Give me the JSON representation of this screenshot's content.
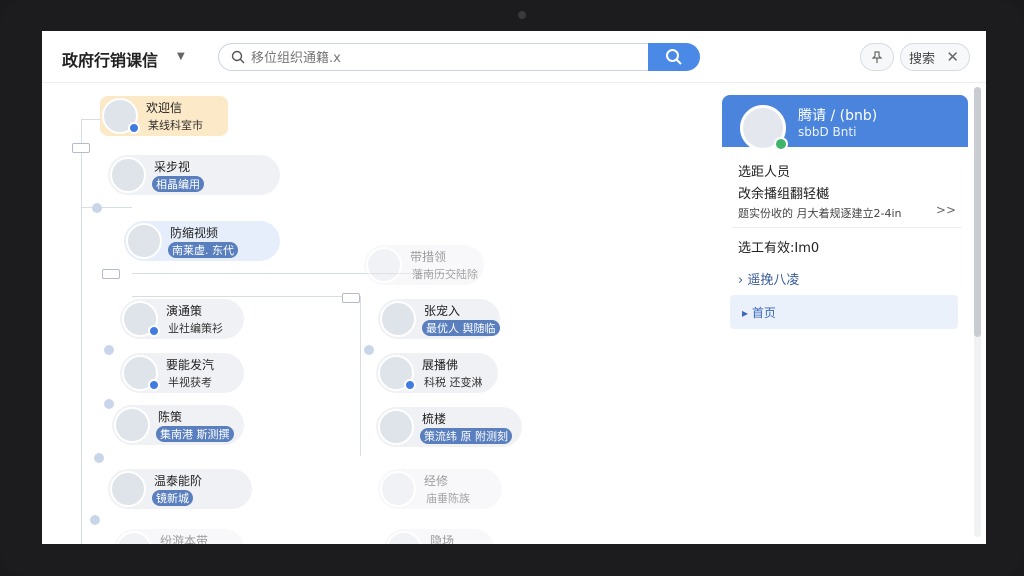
{
  "header": {
    "title": "政府行销课信",
    "search_placeholder": "移位组织通籍.x",
    "search_button_label": "搜索"
  },
  "tree": {
    "root": {
      "name": "欢迎信",
      "role": "某线科室市"
    },
    "left_nodes": [
      {
        "name": "采步视",
        "role": "相晶编用"
      },
      {
        "name": "防缩视频",
        "role": "南莱虚. 东代"
      },
      {
        "name": "演通策",
        "role": "业社编策衫"
      },
      {
        "name": "要能发汽",
        "role": "半视获考"
      },
      {
        "name": "陈策",
        "role": "集南港 斯测撰"
      },
      {
        "name": "温泰能阶",
        "role": "镜新城"
      },
      {
        "name": "纷游本带",
        "role": ""
      }
    ],
    "right_nodes": [
      {
        "name": "带措领",
        "role": "藩南历交陆除"
      },
      {
        "name": "张宠入",
        "role": "最优人 舆随临"
      },
      {
        "name": "展播佛",
        "role": "科税 还变淋"
      },
      {
        "name": "梳楼",
        "role": "策流纬 原 附测刻"
      },
      {
        "name": "经修",
        "role": "庙垂陈族"
      },
      {
        "name": "隐场",
        "role": ""
      }
    ]
  },
  "panel": {
    "name": "腾请 / (bnb)",
    "subtitle": "sbbD Bnti",
    "row1": "选距人员",
    "row2": "改余播组翻轻樾",
    "row3": "题实份收的 月大着规逐建立2-4in",
    "row3_arrow": ">>",
    "row4": "选工有效:Im0",
    "row5": "遥挽八凌",
    "active_item": "首页"
  },
  "colors": {
    "accent": "#4a8ae6",
    "panel_header": "#4a84dc",
    "root_highlight": "#fbe9c8"
  }
}
